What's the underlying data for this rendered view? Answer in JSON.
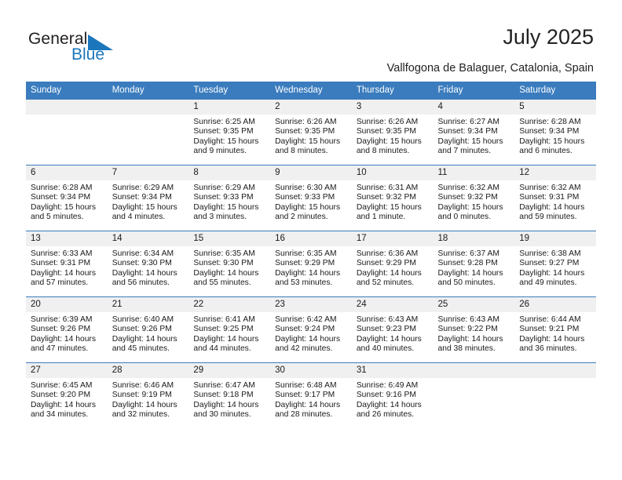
{
  "logo": {
    "primary_text": "General",
    "secondary_text": "Blue",
    "triangle_icon": "triangle-icon",
    "primary_color": "#231f20",
    "secondary_color": "#1b76bc"
  },
  "header": {
    "title": "July 2025",
    "subtitle": "Vallfogona de Balaguer, Catalonia, Spain"
  },
  "theme": {
    "header_blue": "#3a7cbe",
    "daynum_gray": "#f0f0f0",
    "text_color": "#1a1a1a"
  },
  "calendar": {
    "weekday_headers": [
      "Sunday",
      "Monday",
      "Tuesday",
      "Wednesday",
      "Thursday",
      "Friday",
      "Saturday"
    ],
    "weeks": [
      [
        {
          "day": "",
          "sunrise": "",
          "sunset": "",
          "daylight_line1": "",
          "daylight_line2": ""
        },
        {
          "day": "",
          "sunrise": "",
          "sunset": "",
          "daylight_line1": "",
          "daylight_line2": ""
        },
        {
          "day": "1",
          "sunrise": "Sunrise: 6:25 AM",
          "sunset": "Sunset: 9:35 PM",
          "daylight_line1": "Daylight: 15 hours",
          "daylight_line2": "and 9 minutes."
        },
        {
          "day": "2",
          "sunrise": "Sunrise: 6:26 AM",
          "sunset": "Sunset: 9:35 PM",
          "daylight_line1": "Daylight: 15 hours",
          "daylight_line2": "and 8 minutes."
        },
        {
          "day": "3",
          "sunrise": "Sunrise: 6:26 AM",
          "sunset": "Sunset: 9:35 PM",
          "daylight_line1": "Daylight: 15 hours",
          "daylight_line2": "and 8 minutes."
        },
        {
          "day": "4",
          "sunrise": "Sunrise: 6:27 AM",
          "sunset": "Sunset: 9:34 PM",
          "daylight_line1": "Daylight: 15 hours",
          "daylight_line2": "and 7 minutes."
        },
        {
          "day": "5",
          "sunrise": "Sunrise: 6:28 AM",
          "sunset": "Sunset: 9:34 PM",
          "daylight_line1": "Daylight: 15 hours",
          "daylight_line2": "and 6 minutes."
        }
      ],
      [
        {
          "day": "6",
          "sunrise": "Sunrise: 6:28 AM",
          "sunset": "Sunset: 9:34 PM",
          "daylight_line1": "Daylight: 15 hours",
          "daylight_line2": "and 5 minutes."
        },
        {
          "day": "7",
          "sunrise": "Sunrise: 6:29 AM",
          "sunset": "Sunset: 9:34 PM",
          "daylight_line1": "Daylight: 15 hours",
          "daylight_line2": "and 4 minutes."
        },
        {
          "day": "8",
          "sunrise": "Sunrise: 6:29 AM",
          "sunset": "Sunset: 9:33 PM",
          "daylight_line1": "Daylight: 15 hours",
          "daylight_line2": "and 3 minutes."
        },
        {
          "day": "9",
          "sunrise": "Sunrise: 6:30 AM",
          "sunset": "Sunset: 9:33 PM",
          "daylight_line1": "Daylight: 15 hours",
          "daylight_line2": "and 2 minutes."
        },
        {
          "day": "10",
          "sunrise": "Sunrise: 6:31 AM",
          "sunset": "Sunset: 9:32 PM",
          "daylight_line1": "Daylight: 15 hours",
          "daylight_line2": "and 1 minute."
        },
        {
          "day": "11",
          "sunrise": "Sunrise: 6:32 AM",
          "sunset": "Sunset: 9:32 PM",
          "daylight_line1": "Daylight: 15 hours",
          "daylight_line2": "and 0 minutes."
        },
        {
          "day": "12",
          "sunrise": "Sunrise: 6:32 AM",
          "sunset": "Sunset: 9:31 PM",
          "daylight_line1": "Daylight: 14 hours",
          "daylight_line2": "and 59 minutes."
        }
      ],
      [
        {
          "day": "13",
          "sunrise": "Sunrise: 6:33 AM",
          "sunset": "Sunset: 9:31 PM",
          "daylight_line1": "Daylight: 14 hours",
          "daylight_line2": "and 57 minutes."
        },
        {
          "day": "14",
          "sunrise": "Sunrise: 6:34 AM",
          "sunset": "Sunset: 9:30 PM",
          "daylight_line1": "Daylight: 14 hours",
          "daylight_line2": "and 56 minutes."
        },
        {
          "day": "15",
          "sunrise": "Sunrise: 6:35 AM",
          "sunset": "Sunset: 9:30 PM",
          "daylight_line1": "Daylight: 14 hours",
          "daylight_line2": "and 55 minutes."
        },
        {
          "day": "16",
          "sunrise": "Sunrise: 6:35 AM",
          "sunset": "Sunset: 9:29 PM",
          "daylight_line1": "Daylight: 14 hours",
          "daylight_line2": "and 53 minutes."
        },
        {
          "day": "17",
          "sunrise": "Sunrise: 6:36 AM",
          "sunset": "Sunset: 9:29 PM",
          "daylight_line1": "Daylight: 14 hours",
          "daylight_line2": "and 52 minutes."
        },
        {
          "day": "18",
          "sunrise": "Sunrise: 6:37 AM",
          "sunset": "Sunset: 9:28 PM",
          "daylight_line1": "Daylight: 14 hours",
          "daylight_line2": "and 50 minutes."
        },
        {
          "day": "19",
          "sunrise": "Sunrise: 6:38 AM",
          "sunset": "Sunset: 9:27 PM",
          "daylight_line1": "Daylight: 14 hours",
          "daylight_line2": "and 49 minutes."
        }
      ],
      [
        {
          "day": "20",
          "sunrise": "Sunrise: 6:39 AM",
          "sunset": "Sunset: 9:26 PM",
          "daylight_line1": "Daylight: 14 hours",
          "daylight_line2": "and 47 minutes."
        },
        {
          "day": "21",
          "sunrise": "Sunrise: 6:40 AM",
          "sunset": "Sunset: 9:26 PM",
          "daylight_line1": "Daylight: 14 hours",
          "daylight_line2": "and 45 minutes."
        },
        {
          "day": "22",
          "sunrise": "Sunrise: 6:41 AM",
          "sunset": "Sunset: 9:25 PM",
          "daylight_line1": "Daylight: 14 hours",
          "daylight_line2": "and 44 minutes."
        },
        {
          "day": "23",
          "sunrise": "Sunrise: 6:42 AM",
          "sunset": "Sunset: 9:24 PM",
          "daylight_line1": "Daylight: 14 hours",
          "daylight_line2": "and 42 minutes."
        },
        {
          "day": "24",
          "sunrise": "Sunrise: 6:43 AM",
          "sunset": "Sunset: 9:23 PM",
          "daylight_line1": "Daylight: 14 hours",
          "daylight_line2": "and 40 minutes."
        },
        {
          "day": "25",
          "sunrise": "Sunrise: 6:43 AM",
          "sunset": "Sunset: 9:22 PM",
          "daylight_line1": "Daylight: 14 hours",
          "daylight_line2": "and 38 minutes."
        },
        {
          "day": "26",
          "sunrise": "Sunrise: 6:44 AM",
          "sunset": "Sunset: 9:21 PM",
          "daylight_line1": "Daylight: 14 hours",
          "daylight_line2": "and 36 minutes."
        }
      ],
      [
        {
          "day": "27",
          "sunrise": "Sunrise: 6:45 AM",
          "sunset": "Sunset: 9:20 PM",
          "daylight_line1": "Daylight: 14 hours",
          "daylight_line2": "and 34 minutes."
        },
        {
          "day": "28",
          "sunrise": "Sunrise: 6:46 AM",
          "sunset": "Sunset: 9:19 PM",
          "daylight_line1": "Daylight: 14 hours",
          "daylight_line2": "and 32 minutes."
        },
        {
          "day": "29",
          "sunrise": "Sunrise: 6:47 AM",
          "sunset": "Sunset: 9:18 PM",
          "daylight_line1": "Daylight: 14 hours",
          "daylight_line2": "and 30 minutes."
        },
        {
          "day": "30",
          "sunrise": "Sunrise: 6:48 AM",
          "sunset": "Sunset: 9:17 PM",
          "daylight_line1": "Daylight: 14 hours",
          "daylight_line2": "and 28 minutes."
        },
        {
          "day": "31",
          "sunrise": "Sunrise: 6:49 AM",
          "sunset": "Sunset: 9:16 PM",
          "daylight_line1": "Daylight: 14 hours",
          "daylight_line2": "and 26 minutes."
        },
        {
          "day": "",
          "sunrise": "",
          "sunset": "",
          "daylight_line1": "",
          "daylight_line2": ""
        },
        {
          "day": "",
          "sunrise": "",
          "sunset": "",
          "daylight_line1": "",
          "daylight_line2": ""
        }
      ]
    ]
  }
}
